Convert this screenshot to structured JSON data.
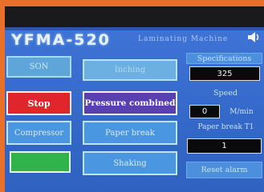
{
  "header": {
    "title": "YFMA-520",
    "subtitle": "Laminating Machine"
  },
  "left_buttons": {
    "b1": "SON",
    "stop": "Stop",
    "compressor": "Compressor",
    "b4": ""
  },
  "middle_buttons": {
    "b1": "Inching",
    "pressure": "Pressure combined",
    "paper_break": "Paper break",
    "shaking": "Shaking"
  },
  "right_panel": {
    "spec_label": "Specifications",
    "spec_value": "325",
    "speed_label": "Speed",
    "speed_value": "0",
    "speed_unit": "M/min",
    "paper_break_label": "Paper break T1",
    "paper_break_value": "1",
    "reset_label": "Reset alarm"
  },
  "colors": {
    "orange_frame": "#e8702a",
    "screen_blue": "#3468c9",
    "stop_red": "#e1252c",
    "pressure_purple": "#5a3fb0",
    "active_green": "#2fb34a"
  },
  "icons": {
    "speaker": "speaker-icon"
  }
}
